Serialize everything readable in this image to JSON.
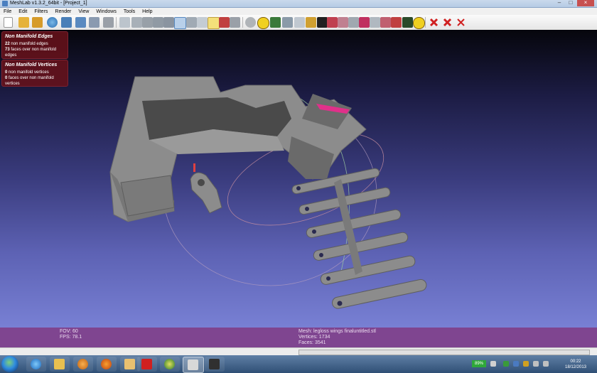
{
  "window": {
    "title": "MeshLab v1.3.2_64bit - [Project_1]"
  },
  "menu": [
    "File",
    "Edit",
    "Filters",
    "Render",
    "View",
    "Windows",
    "Tools",
    "Help"
  ],
  "panels": [
    {
      "title": "Non Manifold Edges",
      "lines": [
        {
          "count": "22",
          "text": "non manifold edges"
        },
        {
          "count": "73",
          "text": "faces over non manifold edges"
        }
      ]
    },
    {
      "title": "Non Manifold Vertices",
      "lines": [
        {
          "count": "0",
          "text": "non manifold vertices"
        },
        {
          "count": "0",
          "text": "faces over non manifold vertices"
        }
      ]
    }
  ],
  "info": {
    "fov": "FOV: 60",
    "fps": "FPS:   78.1",
    "mesh": "Mesh: legloss wings finaluntitled.stl",
    "vertices": "Vertices: 1734",
    "faces": "Faces: 3541"
  },
  "tray": {
    "battery": "89%",
    "time": "00:22",
    "date": "18/12/2013"
  },
  "colors": {
    "viewport_top": "#06060c",
    "viewport_bottom": "#7880d4",
    "info_bar": "#7f4590",
    "panel": "#69121a",
    "mesh": "#8c8c8c"
  }
}
